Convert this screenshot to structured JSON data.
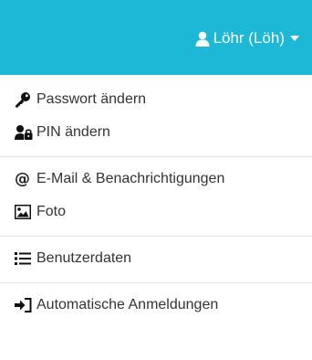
{
  "header": {
    "user_label": "Löhr (Löh)",
    "user_icon": "user-icon",
    "caret_icon": "caret-down-icon",
    "background_color": "#1eb8d7"
  },
  "menu": {
    "groups": [
      {
        "items": [
          {
            "label": "Passwort ändern",
            "icon": "key-icon"
          },
          {
            "label": "PIN ändern",
            "icon": "user-lock-icon"
          }
        ]
      },
      {
        "items": [
          {
            "label": "E-Mail & Benachrichtigungen",
            "icon": "at-icon"
          },
          {
            "label": "Foto",
            "icon": "image-icon"
          }
        ]
      },
      {
        "items": [
          {
            "label": "Benutzerdaten",
            "icon": "list-icon"
          }
        ]
      },
      {
        "items": [
          {
            "label": "Automatische Anmeldungen",
            "icon": "sign-in-icon"
          }
        ]
      }
    ]
  }
}
